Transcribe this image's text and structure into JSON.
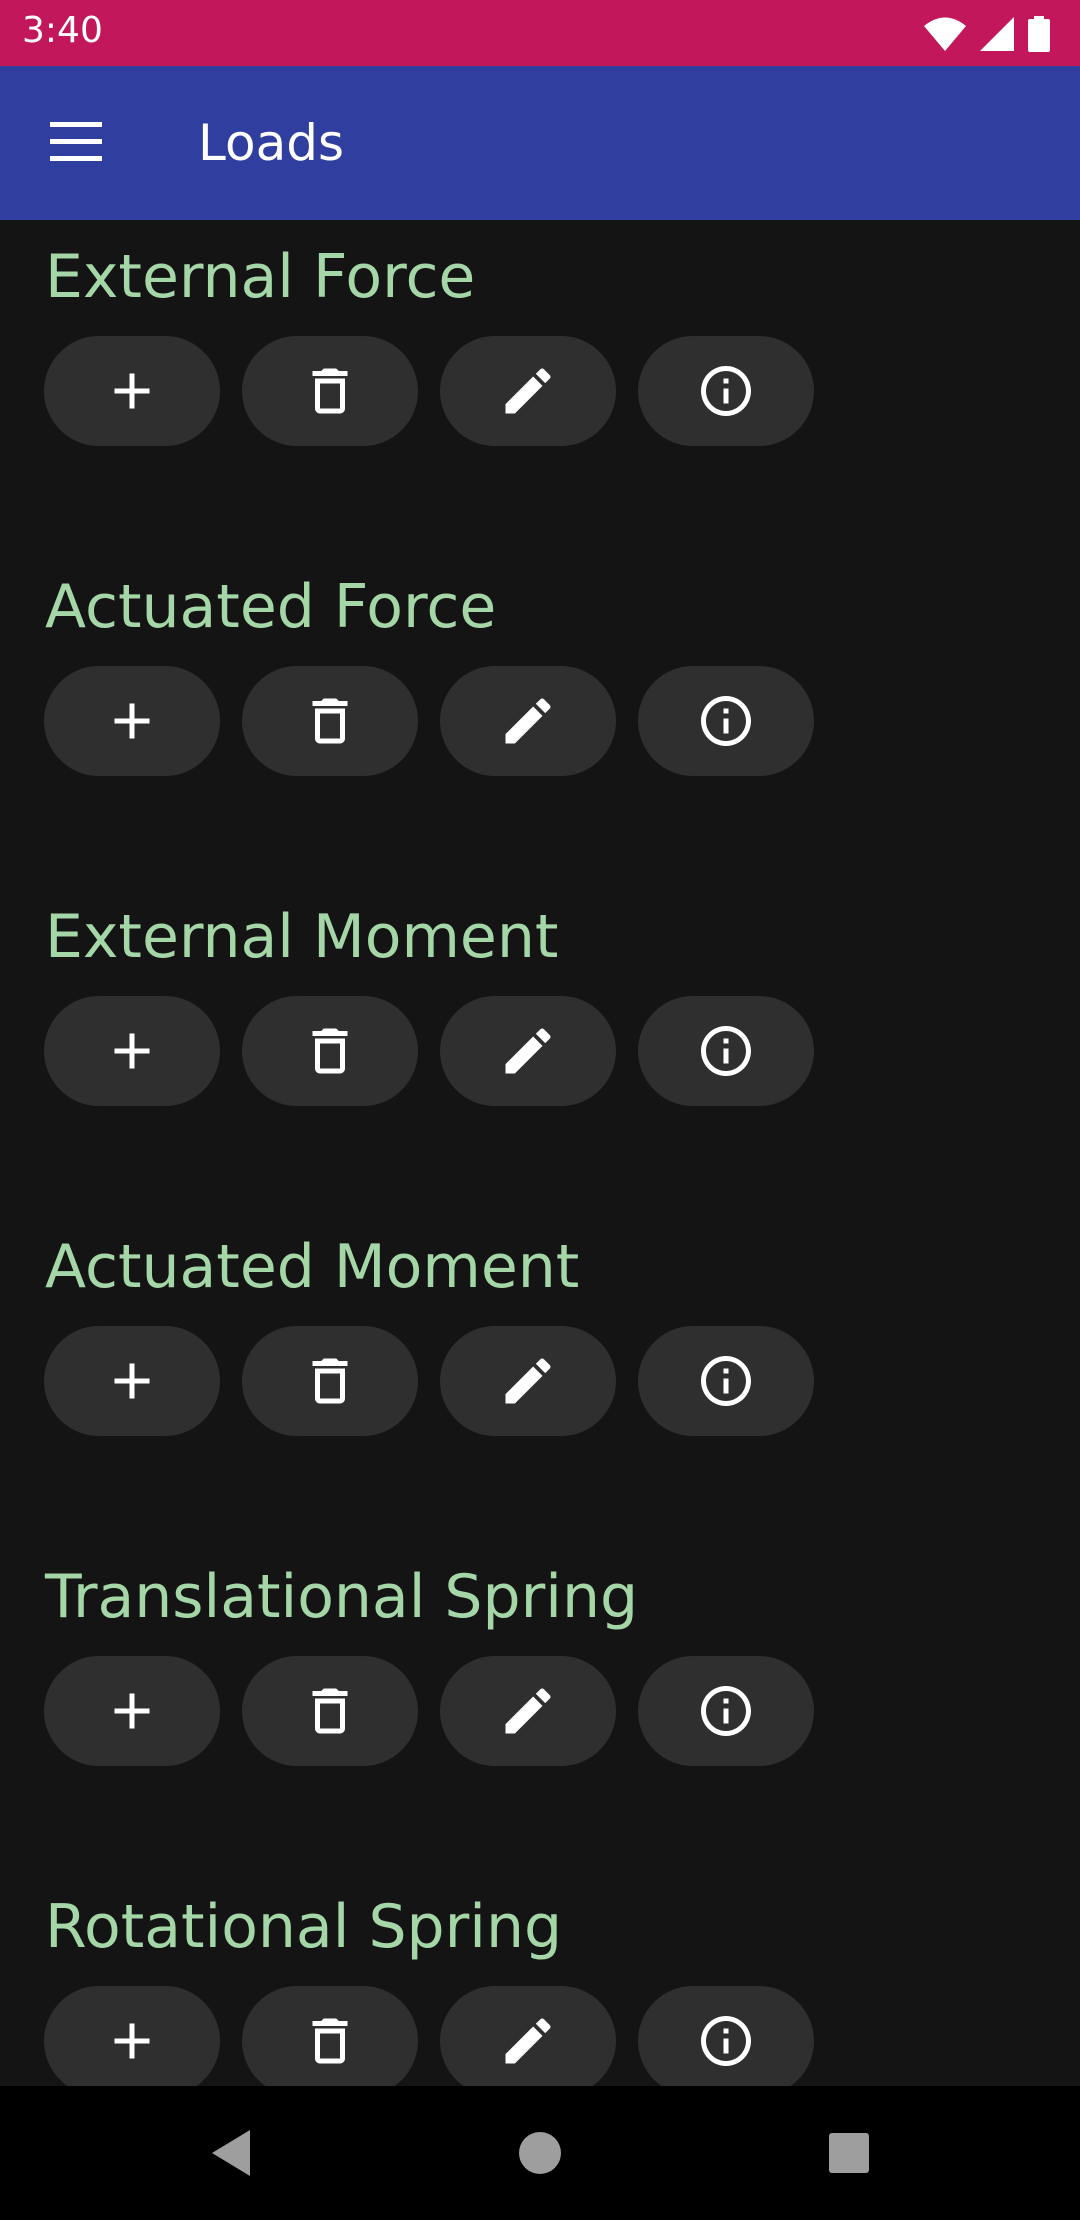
{
  "status_bar": {
    "time": "3:40",
    "icons": [
      "wifi-icon",
      "cell-signal-icon",
      "battery-icon"
    ],
    "color": "#c2185b"
  },
  "app_bar": {
    "title": "Loads",
    "menu_icon": "hamburger-menu-icon",
    "color": "#303f9f"
  },
  "theme": {
    "background": "#141414",
    "section_title_color": "#a5d6a7",
    "button_color": "#2f2f2f"
  },
  "sections": [
    {
      "title": "External Force"
    },
    {
      "title": "Actuated Force"
    },
    {
      "title": "External Moment"
    },
    {
      "title": "Actuated Moment"
    },
    {
      "title": "Translational Spring"
    },
    {
      "title": "Rotational Spring"
    }
  ],
  "section_buttons": [
    {
      "name": "add-button",
      "icon": "plus-icon"
    },
    {
      "name": "delete-button",
      "icon": "trash-icon"
    },
    {
      "name": "edit-button",
      "icon": "pencil-icon"
    },
    {
      "name": "info-button",
      "icon": "info-icon"
    }
  ],
  "nav_bar": {
    "buttons": [
      "back-icon",
      "home-icon",
      "recents-icon"
    ]
  }
}
